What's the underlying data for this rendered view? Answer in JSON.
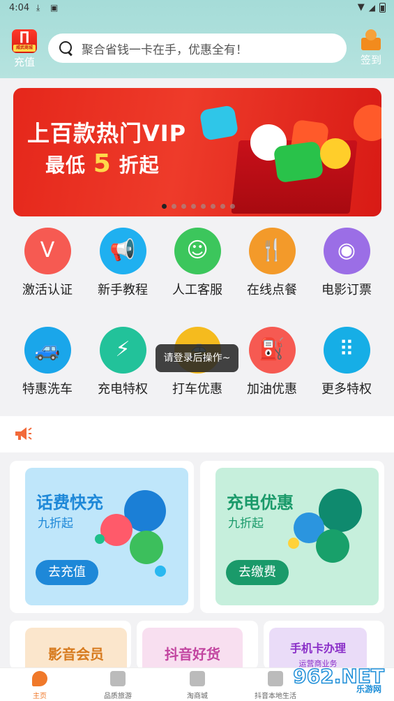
{
  "status": {
    "time": "4:04",
    "icons": [
      "download-icon",
      "a-icon",
      "wifi-icon",
      "signal-icon",
      "battery-icon"
    ]
  },
  "header": {
    "recharge_label": "充值",
    "logo_text": "威武商城",
    "logo_sub": "特权",
    "search_placeholder": "聚合省钱一卡在手，优惠全有！",
    "signin_label": "签到"
  },
  "banner": {
    "line1": "上百款热门VIP",
    "line2_pre": "最低",
    "line2_num": "5",
    "line2_post": "折起",
    "pages": 8,
    "active": 0
  },
  "grid": [
    {
      "label": "激活认证",
      "icon": "v-badge-icon",
      "color": "#f65a52",
      "glyph": "V"
    },
    {
      "label": "新手教程",
      "icon": "megaphone-icon",
      "color": "#1fb0f0",
      "glyph": "📢"
    },
    {
      "label": "人工客服",
      "icon": "chat-smile-icon",
      "color": "#3cc65c",
      "glyph": "☺"
    },
    {
      "label": "在线点餐",
      "icon": "fork-knife-icon",
      "color": "#f39a2a",
      "glyph": "🍴"
    },
    {
      "label": "电影订票",
      "icon": "film-reel-icon",
      "color": "#9b6ee6",
      "glyph": "◉"
    },
    {
      "label": "特惠洗车",
      "icon": "car-wash-icon",
      "color": "#1aa6ea",
      "glyph": "🚙"
    },
    {
      "label": "充电特权",
      "icon": "charging-pile-icon",
      "color": "#22c29a",
      "glyph": "⚡"
    },
    {
      "label": "打车优惠",
      "icon": "taxi-icon",
      "color": "#f5bb1e",
      "glyph": "🚕"
    },
    {
      "label": "加油优惠",
      "icon": "fuel-pump-icon",
      "color": "#f65a52",
      "glyph": "⛽"
    },
    {
      "label": "更多特权",
      "icon": "grid-dots-icon",
      "color": "#16aee6",
      "glyph": "⠿"
    }
  ],
  "toast": "请登录后操作~",
  "cards": [
    {
      "title": "话费快充",
      "sub": "九折起",
      "button": "去充值",
      "bg": "#bfe6fa",
      "accent": "#1e88d8"
    },
    {
      "title": "充电优惠",
      "sub": "九折起",
      "button": "去缴费",
      "bg": "#c6efdc",
      "accent": "#1a9a6a"
    }
  ],
  "row3": [
    {
      "label": "影音会员",
      "bg": "#fbe6cc",
      "color": "#d77b1f"
    },
    {
      "label": "抖音好货",
      "bg": "#f8dff0",
      "color": "#c245a0"
    },
    {
      "label": "手机卡办理",
      "sub": "运营商业务",
      "bg": "#eadcf8",
      "color": "#8a2fc8"
    }
  ],
  "tabs": [
    {
      "label": "主页",
      "active": true
    },
    {
      "label": "品质旅游",
      "active": false
    },
    {
      "label": "淘商城",
      "active": false
    },
    {
      "label": "抖音本地生活",
      "active": false
    }
  ],
  "watermark": {
    "brand": "962.NET",
    "sub": "乐游网"
  }
}
